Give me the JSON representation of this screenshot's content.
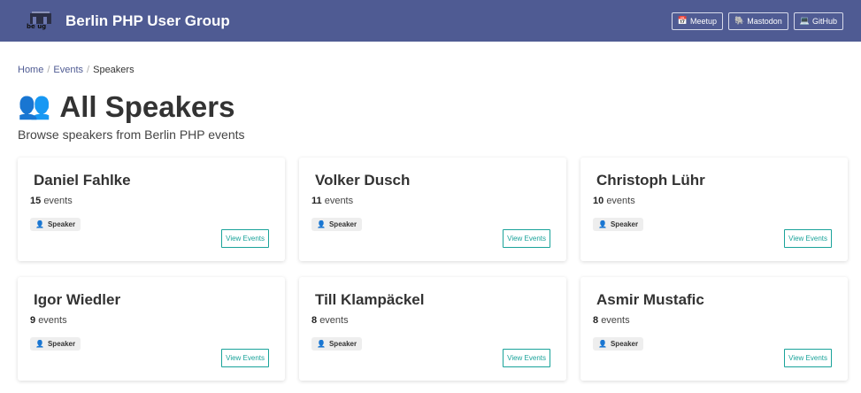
{
  "header": {
    "logo_text": "be  ug",
    "title": "Berlin PHP User Group",
    "links": [
      {
        "icon": "📅",
        "label": "Meetup"
      },
      {
        "icon": "🐘",
        "label": "Mastodon"
      },
      {
        "icon": "💻",
        "label": "GitHub"
      }
    ]
  },
  "breadcrumb": {
    "home": "Home",
    "events": "Events",
    "current": "Speakers",
    "separator": "/"
  },
  "page": {
    "icon": "👥",
    "title": "All Speakers",
    "subtitle": "Browse speakers from Berlin PHP events"
  },
  "speakers": [
    {
      "name": "Daniel Fahlke",
      "count": "15",
      "count_label": "events",
      "badge_icon": "👤",
      "badge": "Speaker",
      "button": "View Events"
    },
    {
      "name": "Volker Dusch",
      "count": "11",
      "count_label": "events",
      "badge_icon": "👤",
      "badge": "Speaker",
      "button": "View Events"
    },
    {
      "name": "Christoph Lühr",
      "count": "10",
      "count_label": "events",
      "badge_icon": "👤",
      "badge": "Speaker",
      "button": "View Events"
    },
    {
      "name": "Igor Wiedler",
      "count": "9",
      "count_label": "events",
      "badge_icon": "👤",
      "badge": "Speaker",
      "button": "View Events"
    },
    {
      "name": "Till Klampäckel",
      "count": "8",
      "count_label": "events",
      "badge_icon": "👤",
      "badge": "Speaker",
      "button": "View Events"
    },
    {
      "name": "Asmir Mustafic",
      "count": "8",
      "count_label": "events",
      "badge_icon": "👤",
      "badge": "Speaker",
      "button": "View Events"
    }
  ],
  "colors": {
    "header_bg": "#4f5b93",
    "link": "#4f5b93",
    "button_accent": "#1aa39a"
  }
}
